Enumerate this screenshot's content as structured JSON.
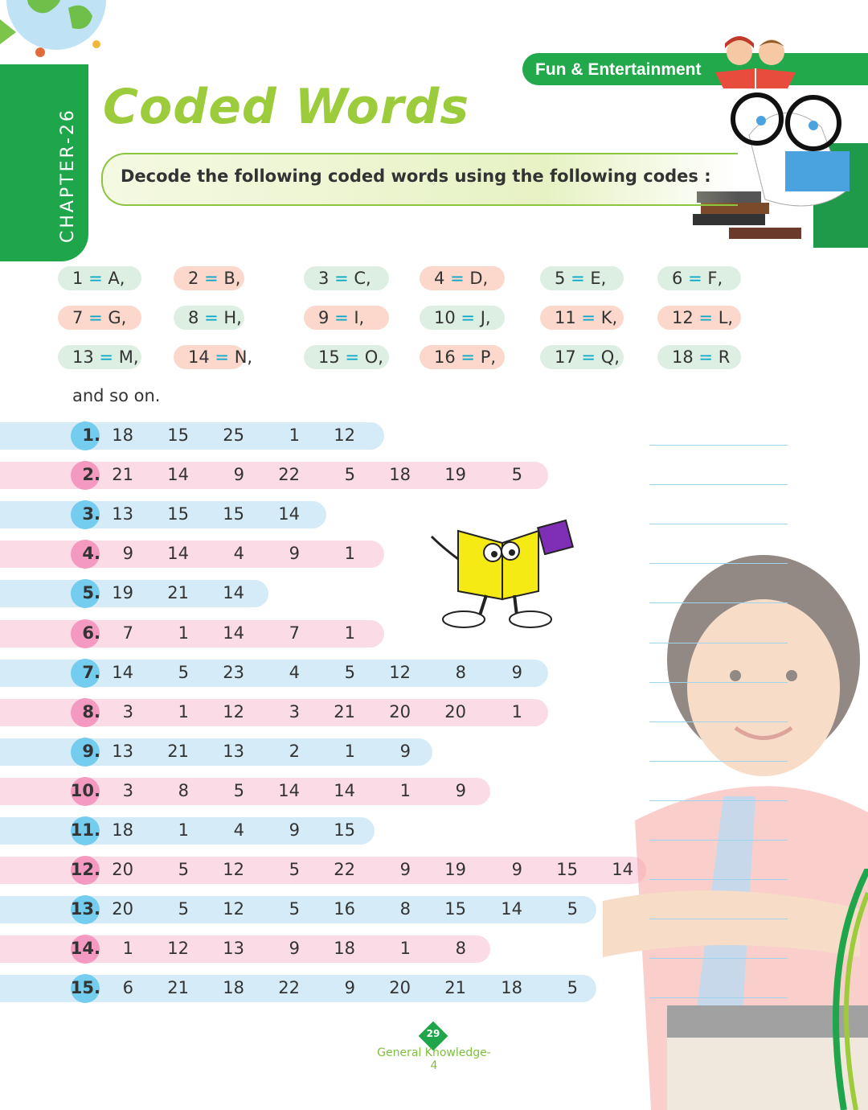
{
  "chapter_label": "CHAPTER-26",
  "section_banner": "Fun & Entertainment",
  "title": "Coded Words",
  "instruction": "Decode the following coded words using the following codes :",
  "codes": [
    {
      "num": "1",
      "letter": "A,"
    },
    {
      "num": "2",
      "letter": "B,"
    },
    {
      "num": "3",
      "letter": "C,"
    },
    {
      "num": "4",
      "letter": "D,"
    },
    {
      "num": "5",
      "letter": "E,"
    },
    {
      "num": "6",
      "letter": "F,"
    },
    {
      "num": "7",
      "letter": "G,"
    },
    {
      "num": "8",
      "letter": "H,"
    },
    {
      "num": "9",
      "letter": "I,"
    },
    {
      "num": "10",
      "letter": "J,"
    },
    {
      "num": "11",
      "letter": "K,"
    },
    {
      "num": "12",
      "letter": "L,"
    },
    {
      "num": "13",
      "letter": "M,"
    },
    {
      "num": "14",
      "letter": "N,"
    },
    {
      "num": "15",
      "letter": "O,"
    },
    {
      "num": "16",
      "letter": "P,"
    },
    {
      "num": "17",
      "letter": "Q,"
    },
    {
      "num": "18",
      "letter": "R"
    }
  ],
  "equals_sign": "=",
  "and_so_on": "and so on.",
  "questions": [
    {
      "label": "1.",
      "numbers": [
        "18",
        "15",
        "25",
        "1",
        "12"
      ]
    },
    {
      "label": "2.",
      "numbers": [
        "21",
        "14",
        "9",
        "22",
        "5",
        "18",
        "19",
        "5"
      ]
    },
    {
      "label": "3.",
      "numbers": [
        "13",
        "15",
        "15",
        "14"
      ]
    },
    {
      "label": "4.",
      "numbers": [
        "9",
        "14",
        "4",
        "9",
        "1"
      ]
    },
    {
      "label": "5.",
      "numbers": [
        "19",
        "21",
        "14"
      ]
    },
    {
      "label": "6.",
      "numbers": [
        "7",
        "1",
        "14",
        "7",
        "1"
      ]
    },
    {
      "label": "7.",
      "numbers": [
        "14",
        "5",
        "23",
        "4",
        "5",
        "12",
        "8",
        "9"
      ]
    },
    {
      "label": "8.",
      "numbers": [
        "3",
        "1",
        "12",
        "3",
        "21",
        "20",
        "20",
        "1"
      ]
    },
    {
      "label": "9.",
      "numbers": [
        "13",
        "21",
        "13",
        "2",
        "1",
        "9"
      ]
    },
    {
      "label": "10.",
      "numbers": [
        "3",
        "8",
        "5",
        "14",
        "14",
        "1",
        "9"
      ]
    },
    {
      "label": "11.",
      "numbers": [
        "18",
        "1",
        "4",
        "9",
        "15"
      ]
    },
    {
      "label": "12.",
      "numbers": [
        "20",
        "5",
        "12",
        "5",
        "22",
        "9",
        "19",
        "9",
        "15",
        "14"
      ]
    },
    {
      "label": "13.",
      "numbers": [
        "20",
        "5",
        "12",
        "5",
        "16",
        "8",
        "15",
        "14",
        "5"
      ]
    },
    {
      "label": "14.",
      "numbers": [
        "1",
        "12",
        "13",
        "9",
        "18",
        "1",
        "8"
      ]
    },
    {
      "label": "15.",
      "numbers": [
        "6",
        "21",
        "18",
        "22",
        "9",
        "20",
        "21",
        "18",
        "5"
      ]
    }
  ],
  "page_number": "29",
  "book_title": "General Knowledge-4",
  "colors": {
    "green": "#1fa64a",
    "title_green": "#9ccb3b",
    "blue_bar": "#d5ecf8",
    "pink_bar": "#fbdbe6",
    "blue_circle": "#74cdee",
    "pink_circle": "#f49ac1",
    "equals_cyan": "#00a6c8"
  }
}
